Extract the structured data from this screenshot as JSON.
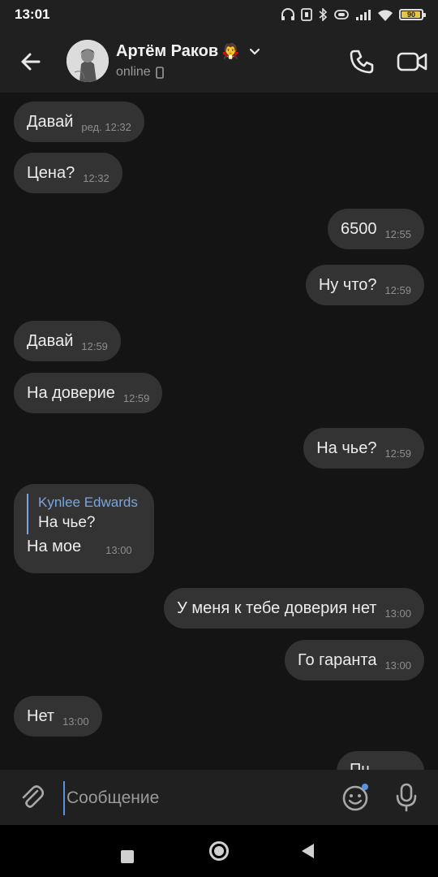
{
  "status_bar": {
    "time": "13:01",
    "battery": "90",
    "battery_level": 0.9
  },
  "header": {
    "contact_name": "Артём Раков",
    "contact_emoji": "🧛",
    "status": "online",
    "icons": [
      "back-arrow-icon",
      "phone-icon",
      "video-camera-icon",
      "chevron-down-icon",
      "mobile-phone-icon"
    ]
  },
  "messages": [
    {
      "side": "left",
      "text": "Давай",
      "time": "ред. 12:32"
    },
    {
      "side": "left",
      "text": "Цена?",
      "time": "12:32"
    },
    {
      "side": "right",
      "text": "6500",
      "time": "12:55"
    },
    {
      "side": "right",
      "text": "Ну что?",
      "time": "12:59"
    },
    {
      "side": "left",
      "text": "Давай",
      "time": "12:59"
    },
    {
      "side": "left",
      "text": "На доверие",
      "time": "12:59"
    },
    {
      "side": "right",
      "text": "На чье?",
      "time": "12:59"
    },
    {
      "side": "left",
      "reply_author": "Kynlee Edwards",
      "reply_text": "На чье?",
      "text": "На мое",
      "time": "13:00"
    },
    {
      "side": "right",
      "text": "У меня к тебе доверия нет",
      "time": "13:00"
    },
    {
      "side": "right",
      "text": "Го гаранта",
      "time": "13:00"
    },
    {
      "side": "left",
      "text": "Нет",
      "time": "13:00"
    },
    {
      "side": "right",
      "text": "Пч",
      "time": ""
    }
  ],
  "input": {
    "placeholder": "Сообщение"
  },
  "colors": {
    "background": "#141414",
    "bar": "#202020",
    "bubble": "#333333",
    "accent": "#7aa6e0"
  }
}
